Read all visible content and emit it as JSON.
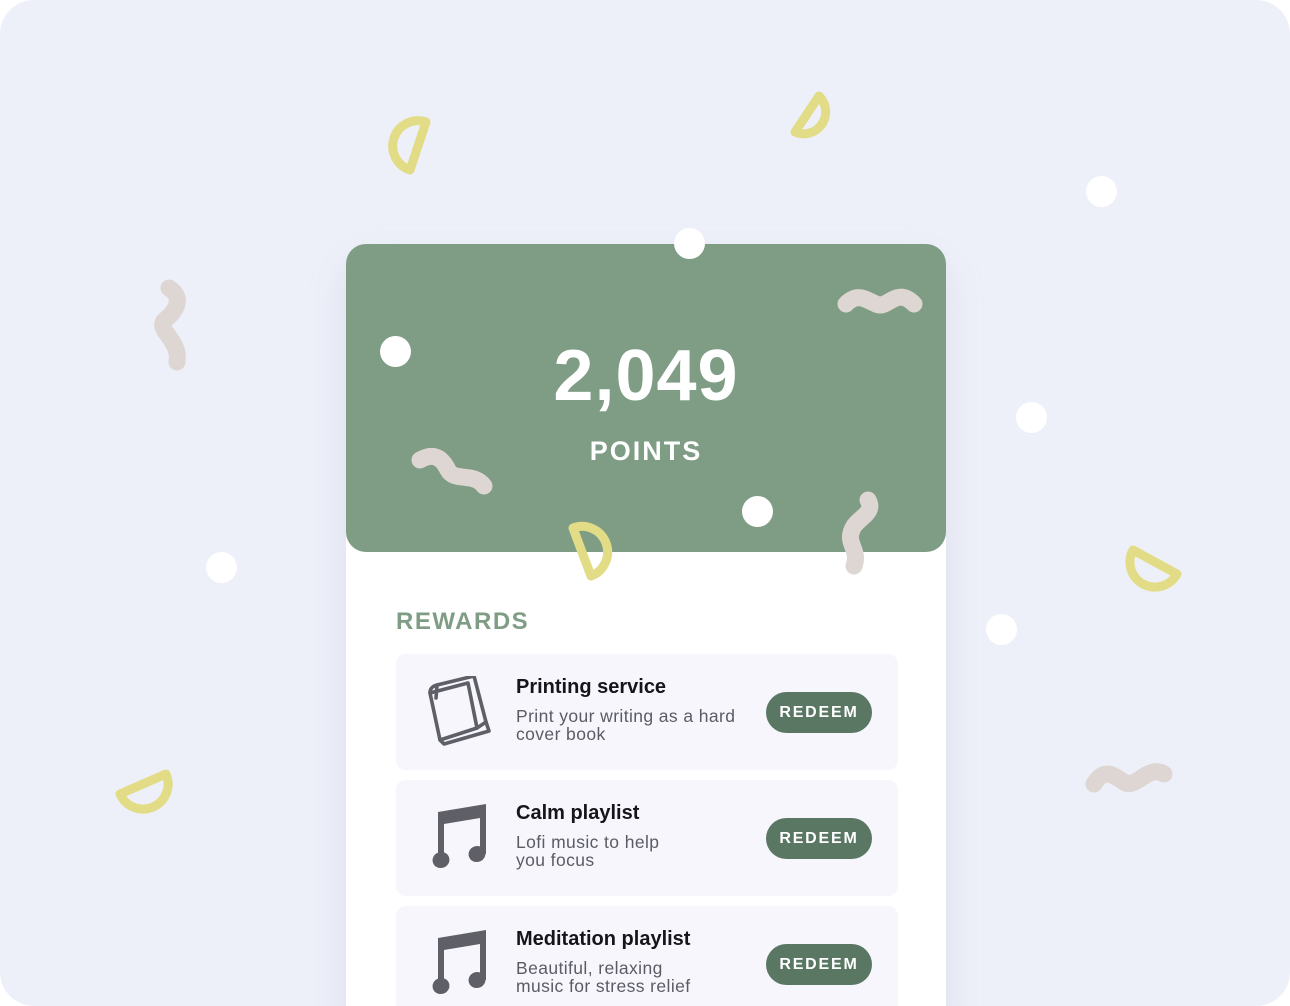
{
  "points": {
    "value": "2,049",
    "label": "POINTS"
  },
  "rewards": {
    "heading": "REWARDS",
    "items": [
      {
        "title": "Printing service",
        "description": "Print your writing as a hard cover book",
        "button_label": "REDEEM",
        "icon": "book-icon"
      },
      {
        "title": "Calm playlist",
        "description": "Lofi music to help you focus",
        "button_label": "REDEEM",
        "icon": "music-note-icon"
      },
      {
        "title": "Meditation playlist",
        "description": "Beautiful, relaxing music for stress relief",
        "button_label": "REDEEM",
        "icon": "music-note-icon"
      }
    ]
  },
  "colors": {
    "background": "#eef0f9",
    "panel_green": "#7f9c85",
    "button_green": "#5a7763",
    "confetti_yellow": "#e2dc86",
    "confetti_beige": "#ddd6d2",
    "item_background": "#f6f6fc"
  }
}
